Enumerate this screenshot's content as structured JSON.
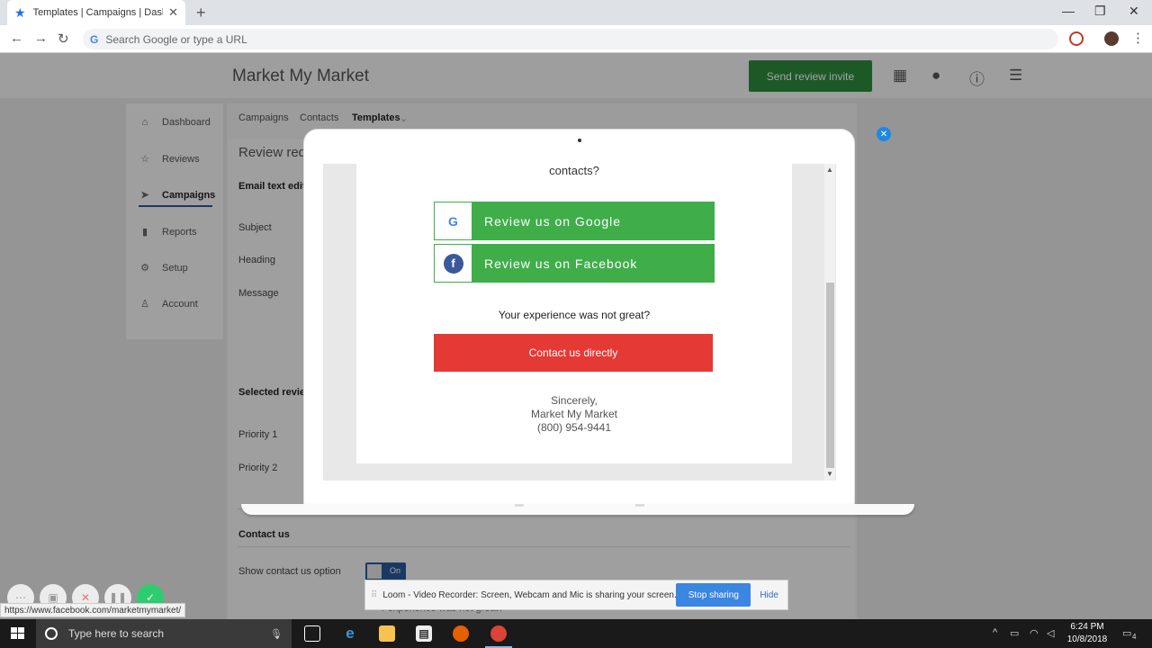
{
  "browser": {
    "tab_title": "Templates | Campaigns | Dashbo",
    "omnibox_placeholder": "Search Google or type a URL",
    "status_url": "https://www.facebook.com/marketmymarket/"
  },
  "app": {
    "brand": "Market My Market",
    "send_button": "Send review invite"
  },
  "sidebar": {
    "items": [
      {
        "label": "Dashboard",
        "icon": "home-icon"
      },
      {
        "label": "Reviews",
        "icon": "star-icon"
      },
      {
        "label": "Campaigns",
        "icon": "send-icon"
      },
      {
        "label": "Reports",
        "icon": "bar-chart-icon"
      },
      {
        "label": "Setup",
        "icon": "gear-icon"
      },
      {
        "label": "Account",
        "icon": "person-icon"
      }
    ]
  },
  "subnav": {
    "campaigns": "Campaigns",
    "contacts": "Contacts",
    "templates": "Templates"
  },
  "main": {
    "title": "Review req",
    "email_text_editor": "Email text edito",
    "subject": "Subject",
    "heading": "Heading",
    "message": "Message",
    "selected_review": "Selected review",
    "priority1": "Priority 1",
    "priority2": "Priority 2",
    "contact_us": "Contact us",
    "show_contact": "Show contact us option",
    "toggle_on": "On",
    "hidden_text": "r experience was not great?"
  },
  "preview": {
    "question_tail": "contacts?",
    "google_button": "Review us on Google",
    "facebook_button": "Review us on Facebook",
    "not_great": "Your experience was not great?",
    "contact_button": "Contact us directly",
    "sincerely": "Sincerely,",
    "company": "Market My Market",
    "phone": "(800) 954-9441"
  },
  "loom": {
    "message": "Loom - Video Recorder: Screen, Webcam and Mic is sharing your screen.",
    "stop": "Stop sharing",
    "hide": "Hide"
  },
  "taskbar": {
    "search_placeholder": "Type here to search",
    "time": "6:24 PM",
    "date": "10/8/2018",
    "notifications": "4"
  },
  "colors": {
    "send_green": "#2e8b3e",
    "review_green": "#3fae49",
    "contact_red": "#e53935",
    "facebook_blue": "#3b5998",
    "loom_blue": "#3a86e0"
  }
}
